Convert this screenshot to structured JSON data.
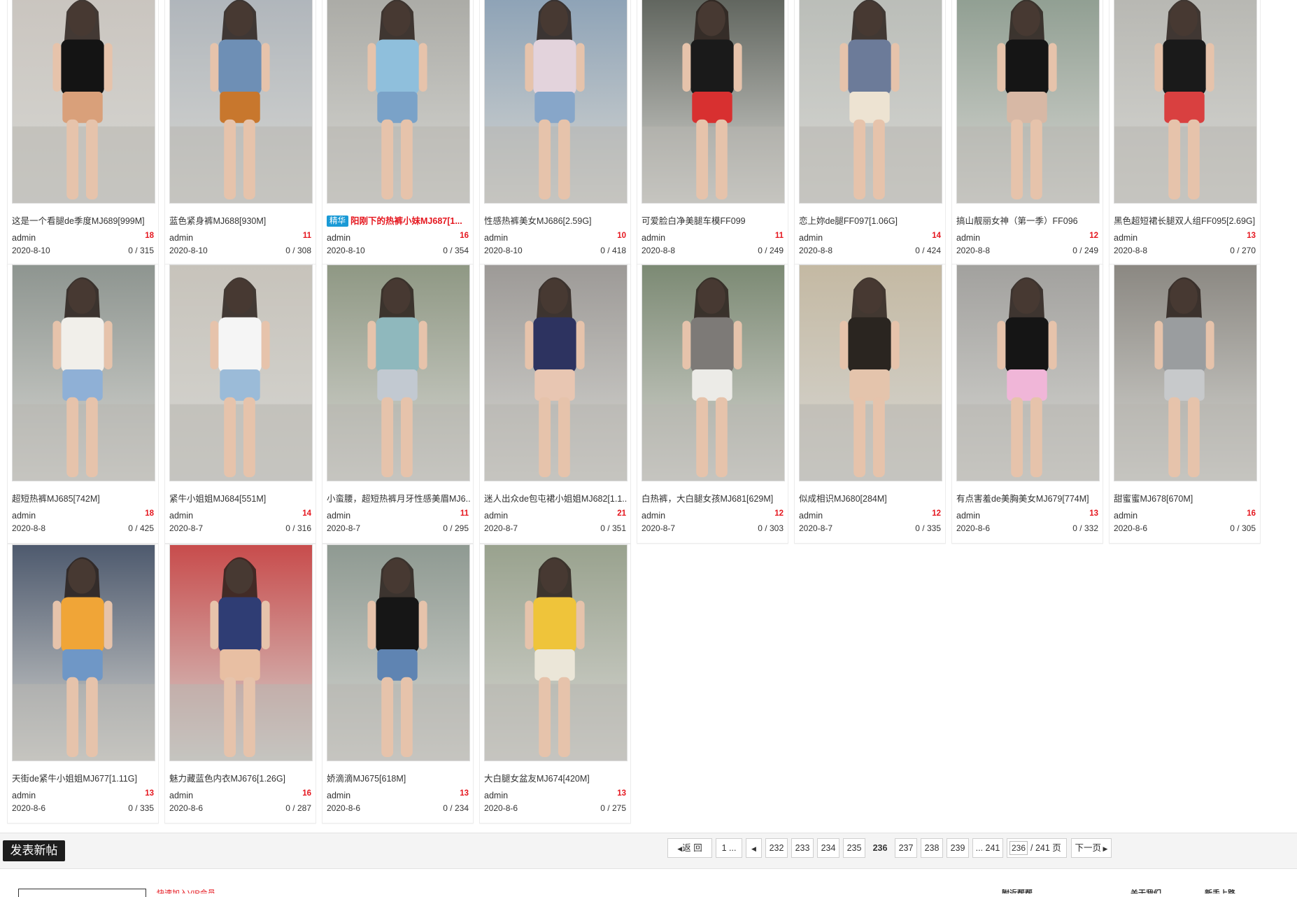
{
  "posts": [
    {
      "title": "这是一个看腿de季度MJ689[999M]",
      "author": "admin",
      "replies": "18",
      "date": "2020-8-10",
      "views": "0 / 315",
      "colors": [
        "#c9c4be",
        "#141414",
        "#d9a07a"
      ]
    },
    {
      "title": "蓝色紧身裤MJ688[930M]",
      "author": "admin",
      "replies": "11",
      "date": "2020-8-10",
      "views": "0 / 308",
      "colors": [
        "#aeb4ba",
        "#6e8fb5",
        "#c8772d"
      ]
    },
    {
      "title": "阳刚下的热裤小妹MJ687[1...",
      "badge": "精华",
      "highlight": true,
      "author": "admin",
      "replies": "16",
      "date": "2020-8-10",
      "views": "0 / 354",
      "colors": [
        "#a9a9a4",
        "#8fbfdc",
        "#7aa2c8"
      ]
    },
    {
      "title": "性感热裤美女MJ686[2.59G]",
      "author": "admin",
      "replies": "10",
      "date": "2020-8-10",
      "views": "0 / 418",
      "colors": [
        "#8aa0b5",
        "#e3d3dc",
        "#87a6c9"
      ]
    },
    {
      "title": "可爱脸白净美腿车模FF099",
      "author": "admin",
      "replies": "11",
      "date": "2020-8-8",
      "views": "0 / 249",
      "colors": [
        "#5a5f58",
        "#1a1a1a",
        "#d83030"
      ]
    },
    {
      "title": "恋上妳de腿FF097[1.06G]",
      "author": "admin",
      "replies": "14",
      "date": "2020-8-8",
      "views": "0 / 424",
      "colors": [
        "#b9bcb7",
        "#6c7b99",
        "#ede3d2"
      ]
    },
    {
      "title": "搞山靓丽女神（第一季）FF096",
      "author": "admin",
      "replies": "12",
      "date": "2020-8-8",
      "views": "0 / 249",
      "colors": [
        "#8d9c8f",
        "#151515",
        "#d7b8a5"
      ]
    },
    {
      "title": "黑色超短裙长腿双人组FF095[2.69G]",
      "author": "admin",
      "replies": "13",
      "date": "2020-8-8",
      "views": "0 / 270",
      "colors": [
        "#b6b6b1",
        "#1a1a1a",
        "#d94040"
      ]
    },
    {
      "title": "超短热裤MJ685[742M]",
      "author": "admin",
      "replies": "18",
      "date": "2020-8-8",
      "views": "0 / 425",
      "colors": [
        "#8e9590",
        "#f1efea",
        "#8fb0d6"
      ]
    },
    {
      "title": "紧牛小姐姐MJ684[551M]",
      "author": "admin",
      "replies": "14",
      "date": "2020-8-7",
      "views": "0 / 316",
      "colors": [
        "#c7c3bb",
        "#f5f5f5",
        "#9bbbd8"
      ]
    },
    {
      "title": "小蛮腰，超短热裤月牙性感美眉MJ6...",
      "author": "admin",
      "replies": "11",
      "date": "2020-8-7",
      "views": "0 / 295",
      "colors": [
        "#8f9884",
        "#8fb8bd",
        "#c2c9d1"
      ]
    },
    {
      "title": "迷人出众de包屯裙小姐姐MJ682[1.1...",
      "author": "admin",
      "replies": "21",
      "date": "2020-8-7",
      "views": "0 / 351",
      "colors": [
        "#9d9a97",
        "#2d3360",
        "#e8c6b2"
      ]
    },
    {
      "title": "白热裤，大白腿女孩MJ681[629M]",
      "author": "admin",
      "replies": "12",
      "date": "2020-8-7",
      "views": "0 / 303",
      "colors": [
        "#7c8a74",
        "#7d7a77",
        "#ecebe7"
      ]
    },
    {
      "title": "似成相识MJ680[284M]",
      "author": "admin",
      "replies": "12",
      "date": "2020-8-7",
      "views": "0 / 335",
      "colors": [
        "#c4b9a3",
        "#2a2520",
        "#e4c4ac"
      ]
    },
    {
      "title": "有点害羞de美胸美女MJ679[774M]",
      "author": "admin",
      "replies": "13",
      "date": "2020-8-6",
      "views": "0 / 332",
      "colors": [
        "#a2a19e",
        "#151515",
        "#f0b6d8"
      ]
    },
    {
      "title": "甜蜜蜜MJ678[670M]",
      "author": "admin",
      "replies": "16",
      "date": "2020-8-6",
      "views": "0 / 305",
      "colors": [
        "#8b8882",
        "#9a9d9f",
        "#c7c9cb"
      ]
    },
    {
      "title": "天街de紧牛小姐姐MJ677[1.11G]",
      "author": "admin",
      "replies": "13",
      "date": "2020-8-6",
      "views": "0 / 335",
      "colors": [
        "#4e5a6e",
        "#f0a537",
        "#6f97c6"
      ]
    },
    {
      "title": "魅力藏蓝色内衣MJ676[1.26G]",
      "author": "admin",
      "replies": "16",
      "date": "2020-8-6",
      "views": "0 / 287",
      "colors": [
        "#c84c4c",
        "#2f3d74",
        "#e8bfa3"
      ]
    },
    {
      "title": "娇滴滴MJ675[618M]",
      "author": "admin",
      "replies": "13",
      "date": "2020-8-6",
      "views": "0 / 234",
      "colors": [
        "#8f9a92",
        "#161616",
        "#5f84b2"
      ]
    },
    {
      "title": "大白腿女盆友MJ674[420M]",
      "author": "admin",
      "replies": "13",
      "date": "2020-8-6",
      "views": "0 / 275",
      "colors": [
        "#99a28e",
        "#efc43a",
        "#ebe6d8"
      ]
    }
  ],
  "toolbar": {
    "new_post_label": "发表新帖"
  },
  "pager": {
    "back_label": "返 回",
    "first_label": "1 ...",
    "prev_label": "",
    "pages": [
      "232",
      "233",
      "234",
      "235",
      "236",
      "237",
      "238",
      "239"
    ],
    "current": "236",
    "last_label": "... 241",
    "jump_value": "236",
    "jump_suffix": "/ 241 页",
    "next_label": "下一页"
  },
  "footer": {
    "red_text": "快速加入VIP会员",
    "dark_1": "附近帮帮",
    "dark_2": "关于我们",
    "dark_3": "新手上路"
  }
}
